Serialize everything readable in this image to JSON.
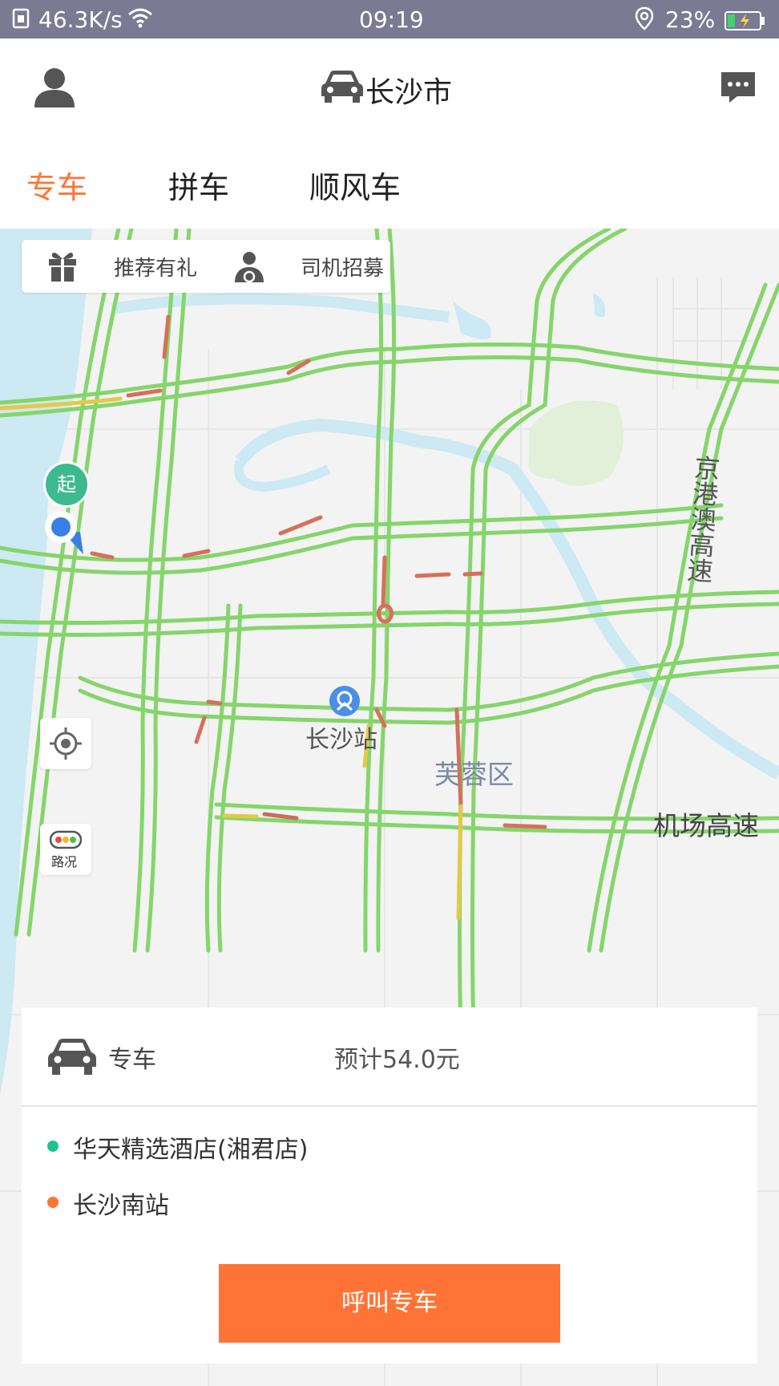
{
  "status_bar": {
    "net_speed": "46.3K/s",
    "time": "09:19",
    "battery": "23%"
  },
  "header": {
    "city": "长沙市"
  },
  "tabs": [
    {
      "label": "专车",
      "active": true
    },
    {
      "label": "拼车",
      "active": false
    },
    {
      "label": "顺风车",
      "active": false
    }
  ],
  "promo": {
    "gift_label": "推荐有礼",
    "driver_label": "司机招募"
  },
  "map": {
    "start_marker": "起",
    "station": "长沙站",
    "district": "芙蓉区",
    "highway_1": "京港澳高速",
    "highway_2": "机场高速",
    "traffic_button": "路况"
  },
  "booking": {
    "service": "专车",
    "estimate": "预计54.0元",
    "origin": "华天精选酒店(湘君店)",
    "destination": "长沙南站",
    "call_button": "呼叫专车"
  },
  "colors": {
    "accent": "#ff7436",
    "origin_dot": "#19c58f",
    "dest_dot": "#ff7436",
    "road": "#85d56b",
    "river": "#cde9f3"
  }
}
